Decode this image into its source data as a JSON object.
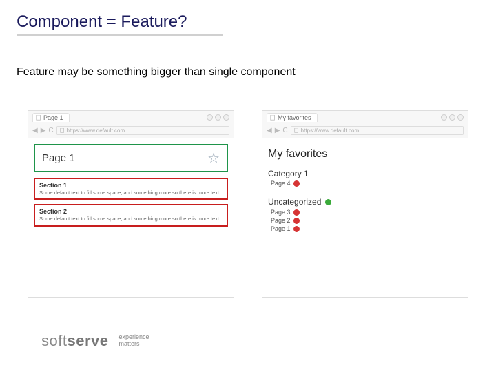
{
  "slide": {
    "title": "Component = Feature?",
    "subtitle": "Feature may be something bigger than single component"
  },
  "browser_left": {
    "tab": "Page 1",
    "url": "https://www.default.com",
    "page_title": "Page 1",
    "sections": [
      {
        "title": "Section 1",
        "body": "Some default text to fill some space, and something more so there is more text"
      },
      {
        "title": "Section 2",
        "body": "Some default text to fill some space, and something more so there is more text"
      }
    ]
  },
  "browser_right": {
    "tab": "My favorites",
    "url": "https://www.default.com",
    "page_title": "My favorites",
    "category": {
      "title": "Category 1",
      "items": [
        "Page 4"
      ]
    },
    "uncategorized": {
      "title": "Uncategorized",
      "items": [
        "Page 3",
        "Page 2",
        "Page 1"
      ]
    }
  },
  "logo": {
    "brand_light": "soft",
    "brand_bold": "serve",
    "tagline1": "experience",
    "tagline2": "matters"
  }
}
